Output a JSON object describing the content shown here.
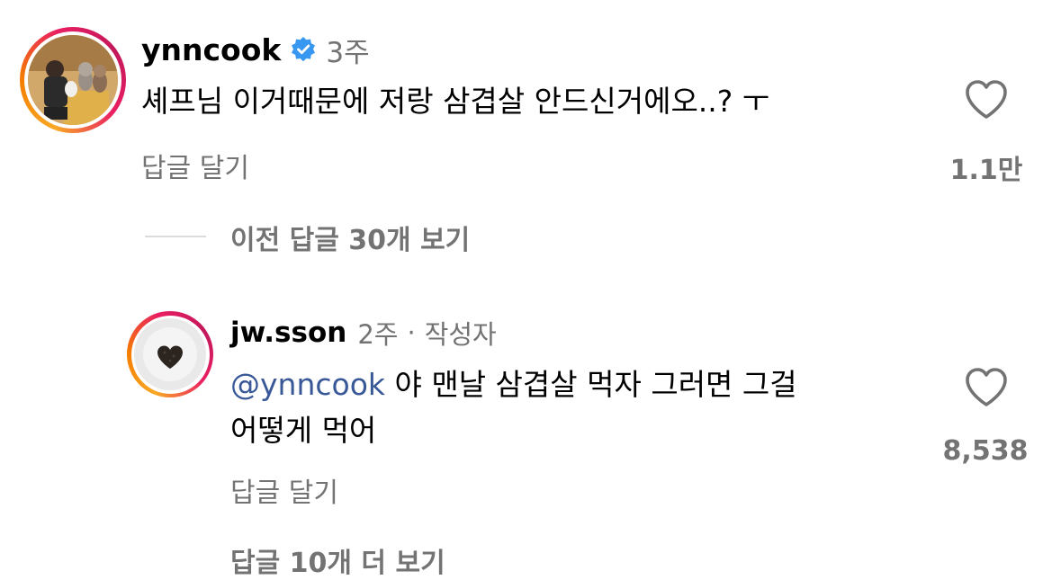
{
  "comments": [
    {
      "username": "ynncook",
      "verified": true,
      "time": "3주",
      "text": "셰프님 이거때문에 저랑 삼겹살 안드신거에오..? ㅜ",
      "reply_label": "답글 달기",
      "likes": "1.1만",
      "avatar_icon": "person-with-dogs-photo"
    }
  ],
  "previous_replies_label": "이전 답글 30개 보기",
  "reply": {
    "username": "jw.sson",
    "time": "2주",
    "separator": "·",
    "author_badge": "작성자",
    "mention": "@ynncook",
    "text_line1": "야 맨날 삼겹살 먹자 그러면 그걸",
    "text_line2": "어떻게 먹어",
    "reply_label": "답글 달기",
    "likes": "8,538",
    "avatar_icon": "heart-shaped-food-on-plate-photo"
  },
  "more_replies_label": "답글 10개 더 보기",
  "colors": {
    "text": "#000000",
    "secondary": "#737373",
    "mention": "#385898",
    "verified": "#3897f0",
    "divider": "#dbdbdb"
  }
}
